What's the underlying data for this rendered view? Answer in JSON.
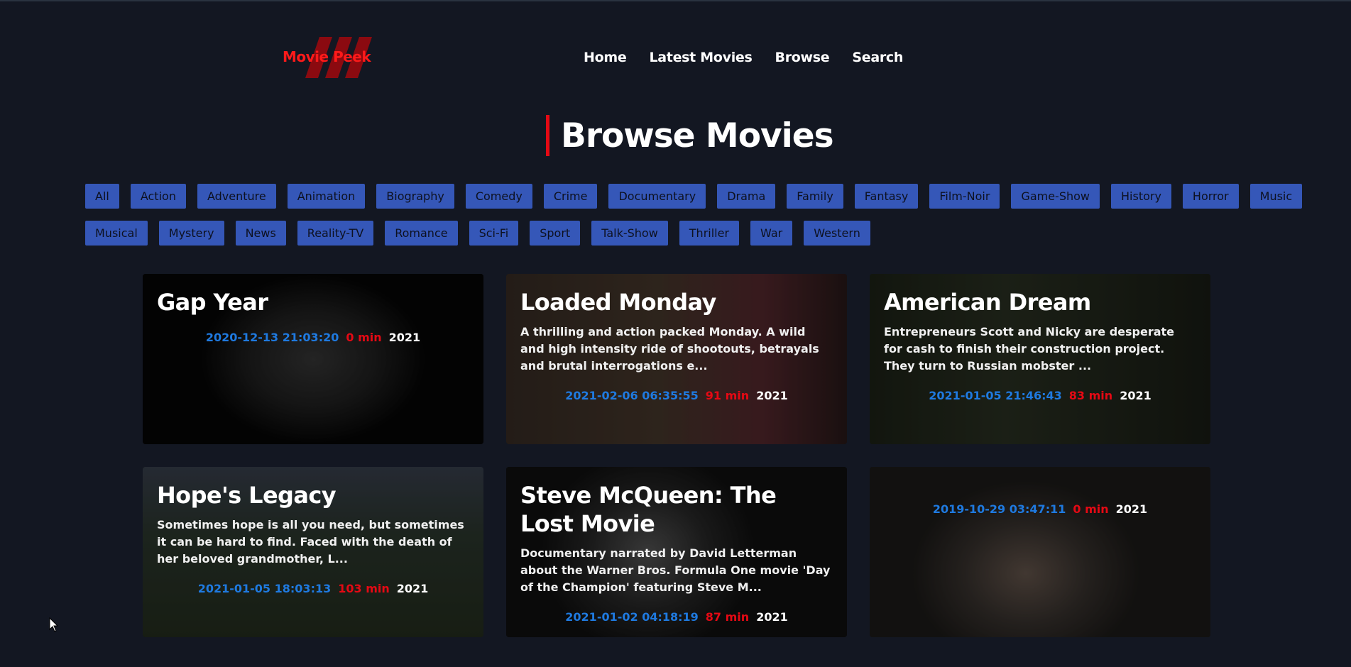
{
  "header": {
    "logo_text": "Movie Peek",
    "nav": [
      "Home",
      "Latest Movies",
      "Browse",
      "Search"
    ]
  },
  "page_title": "Browse Movies",
  "genres": {
    "row1": [
      "All",
      "Action",
      "Adventure",
      "Animation",
      "Biography",
      "Comedy",
      "Crime",
      "Documentary",
      "Drama",
      "Family",
      "Fantasy",
      "Film-Noir",
      "Game-Show",
      "History",
      "Horror",
      "Music"
    ],
    "row2": [
      "Musical",
      "Mystery",
      "News",
      "Reality-TV",
      "Romance",
      "Sci-Fi",
      "Sport",
      "Talk-Show",
      "Thriller",
      "War",
      "Western"
    ]
  },
  "movies": [
    {
      "title": "Gap Year",
      "description": "",
      "date": "2020-12-13 21:03:20",
      "runtime": "0 min",
      "year": "2021"
    },
    {
      "title": "Loaded Monday",
      "description": "A thrilling and action packed Monday. A wild and high intensity ride of shootouts, betrayals and brutal interrogations e...",
      "date": "2021-02-06 06:35:55",
      "runtime": "91 min",
      "year": "2021"
    },
    {
      "title": "American Dream",
      "description": "Entrepreneurs Scott and Nicky are desperate for cash to finish their construction project. They turn to Russian mobster ...",
      "date": "2021-01-05 21:46:43",
      "runtime": "83 min",
      "year": "2021"
    },
    {
      "title": "Hope's Legacy",
      "description": "Sometimes hope is all you need, but sometimes it can be hard to find. Faced with the death of her beloved grandmother, L...",
      "date": "2021-01-05 18:03:13",
      "runtime": "103 min",
      "year": "2021"
    },
    {
      "title": "Steve McQueen: The Lost Movie",
      "description": "Documentary narrated by David Letterman about the Warner Bros. Formula One movie 'Day of the Champion' featuring Steve M...",
      "date": "2021-01-02 04:18:19",
      "runtime": "87 min",
      "year": "2021"
    },
    {
      "title": "",
      "description": "",
      "date": "2019-10-29 03:47:11",
      "runtime": "0 min",
      "year": "2021"
    }
  ],
  "colors": {
    "background": "#131722",
    "accent": "#e50914",
    "genre_button": "#3557b8",
    "date": "#1f7ae0"
  }
}
